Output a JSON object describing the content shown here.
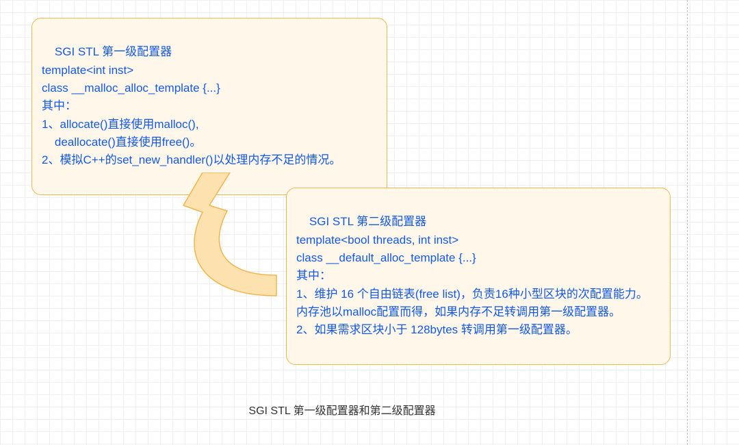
{
  "box1": {
    "text": "SGI STL 第一级配置器\ntemplate<int inst>\nclass __malloc_alloc_template {...}\n其中：\n1、allocate()直接使用malloc(),\n    deallocate()直接使用free()。\n2、模拟C++的set_new_handler()以处理内存不足的情况。"
  },
  "box2": {
    "text": "SGI STL 第二级配置器\ntemplate<bool threads, int inst>\nclass __default_alloc_template {...}\n其中：\n1、维护 16 个自由链表(free list)，负责16种小型区块的次配置能力。\n内存池以malloc配置而得，如果内存不足转调用第一级配置器。\n2、如果需求区块小于 128bytes 转调用第一级配置器。"
  },
  "caption": "SGI STL 第一级配置器和第二级配置器",
  "colors": {
    "boxFill": "#fff7ea",
    "boxBorder": "#f0b64e",
    "text": "#1358e6",
    "arrowFill": "#fde2b0",
    "arrowStroke": "#f0b64e"
  }
}
